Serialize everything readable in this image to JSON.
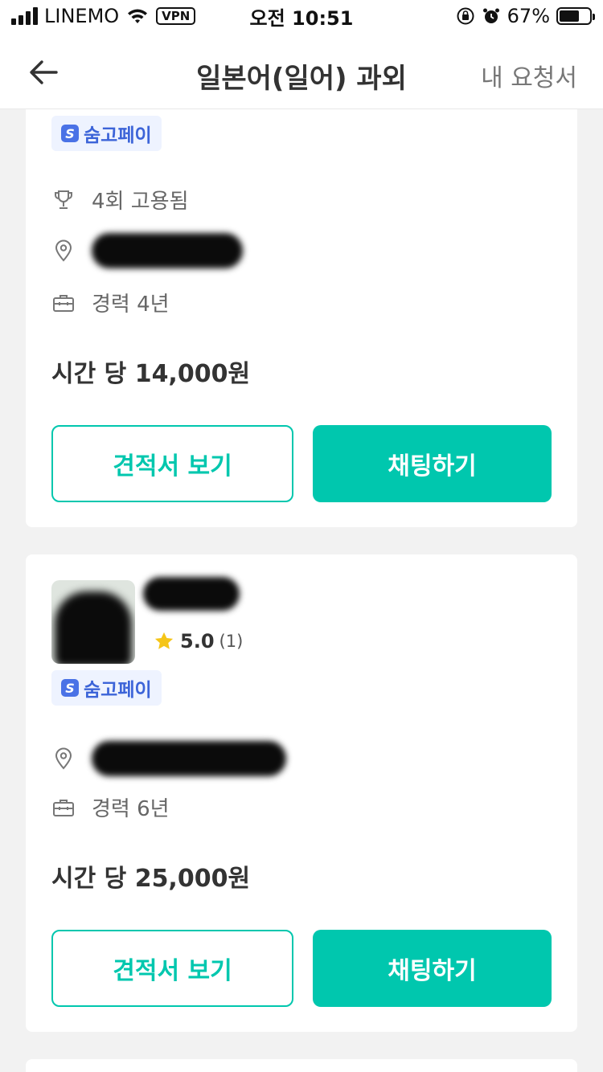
{
  "status_bar": {
    "carrier": "LINEMO",
    "vpn": "VPN",
    "time": "오전 10:51",
    "battery_percent": "67%",
    "battery_level": 0.67
  },
  "header": {
    "title": "일본어(일어) 과외",
    "right_link": "내 요청서"
  },
  "cards": [
    {
      "pay_badge": "숨고페이",
      "hires": "4회 고용됨",
      "experience": "경력 4년",
      "price": "시간 당 14,000원",
      "quote_button": "견적서 보기",
      "chat_button": "채팅하기"
    },
    {
      "rating_score": "5.0",
      "rating_count": "(1)",
      "pay_badge": "숨고페이",
      "experience": "경력 6년",
      "price": "시간 당 25,000원",
      "quote_button": "견적서 보기",
      "chat_button": "채팅하기"
    }
  ],
  "icons": {
    "back": "arrow-left-icon",
    "trophy": "trophy-icon",
    "location": "location-pin-icon",
    "career": "briefcase-icon",
    "star": "star-icon"
  },
  "colors": {
    "accent": "#00c7ae",
    "pay_badge_text": "#3c64d8",
    "star": "#f5c518"
  }
}
